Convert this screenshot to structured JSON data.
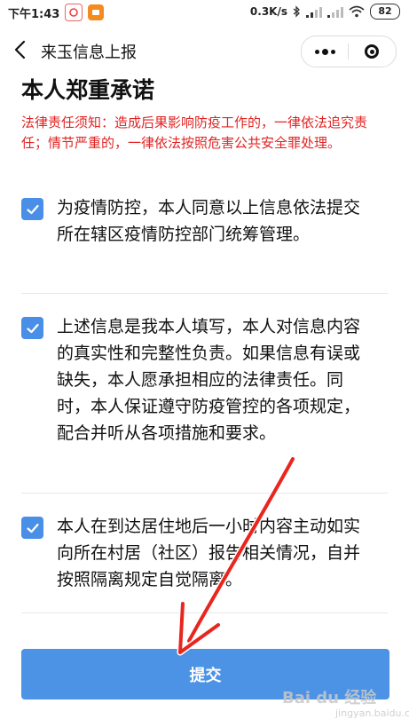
{
  "status_bar": {
    "time": "下午1:43",
    "net_speed": "0.3K/s",
    "battery": "82"
  },
  "nav": {
    "title": "来玉信息上报"
  },
  "page": {
    "title": "本人郑重承诺",
    "legal_notice": "法律责任须知：造成后果影响防疫工作的，一律依法追究责任；情节严重的，一律依法按照危害公共安全罪处理。"
  },
  "pledges": [
    {
      "text": "为疫情防控，本人同意以上信息依法提交所在辖区疫情防控部门统筹管理。",
      "checked": true
    },
    {
      "text": "上述信息是我本人填写，本人对信息内容的真实性和完整性负责。如果信息有误或缺失，本人愿承担相应的法律责任。同时，本人保证遵守防疫管控的各项规定，配合并听从各项措施和要求。",
      "checked": true
    },
    {
      "text": "本人在到达居住地后一小时内容主动如实向所在村居（社区）报告相关情况，自并按照隔离规定自觉隔离。",
      "checked": true
    }
  ],
  "submit": {
    "label": "提交"
  },
  "colors": {
    "accent": "#4c93e6",
    "checkbox": "#4a8fe7",
    "warning_text": "#e02424",
    "annotation_arrow": "#e8261e"
  },
  "watermark": {
    "text": "Bai du 经验",
    "sub": "jingyan.baidu.com"
  }
}
